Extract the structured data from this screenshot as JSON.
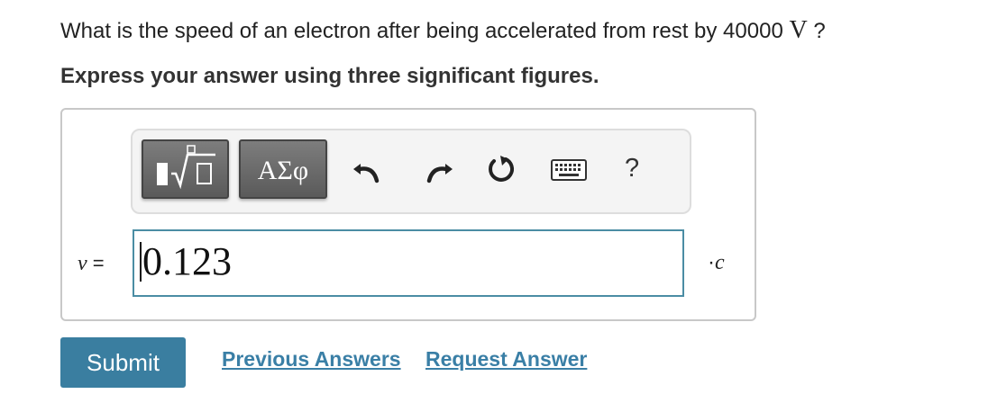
{
  "question": {
    "text_before": "What is the speed of an electron after being accelerated from rest by 40000 ",
    "unit": "V",
    "text_after": " ?"
  },
  "instruction": "Express your answer using three significant figures.",
  "toolbar": {
    "greek_label": "ΑΣφ",
    "help_label": "?",
    "icons": [
      "templates-icon",
      "undo-icon",
      "redo-icon",
      "reset-icon",
      "keyboard-icon"
    ]
  },
  "answer": {
    "variable": "v",
    "equals": " =",
    "value": "0.123",
    "unit_prefix": "·",
    "unit": "c"
  },
  "actions": {
    "submit_label": "Submit",
    "previous_answers_label": "Previous Answers",
    "request_answer_label": "Request Answer"
  },
  "colors": {
    "accent": "#3a7ea0",
    "link": "#3a7fa6",
    "input_border": "#4b8da4"
  }
}
